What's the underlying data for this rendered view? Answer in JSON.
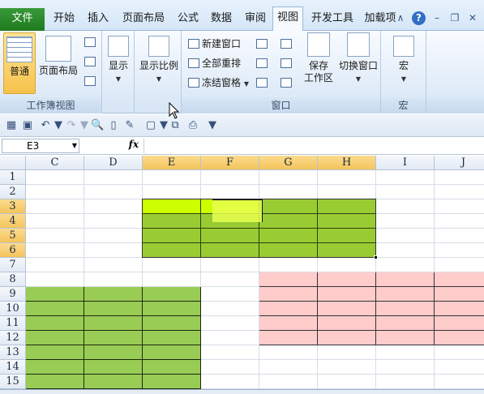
{
  "tabs": {
    "file": "文件",
    "items": [
      "开始",
      "插入",
      "页面布局",
      "公式",
      "数据",
      "审阅",
      "视图",
      "开发工具",
      "加载项"
    ],
    "active": "视图"
  },
  "ribbon": {
    "workbook_views": {
      "normal": "普通",
      "page_layout": "页面布局",
      "group_label": "工作簿视图"
    },
    "show": {
      "label": "显示"
    },
    "zoom": {
      "label": "显示比例"
    },
    "window": {
      "new_window": "新建窗口",
      "arrange_all": "全部重排",
      "freeze_panes": "冻结窗格",
      "save_workspace_line1": "保存",
      "save_workspace_line2": "工作区",
      "switch_windows": "切换窗口",
      "group_label": "窗口"
    },
    "macros": {
      "label": "宏",
      "group_label": "宏"
    }
  },
  "formula_bar": {
    "name_box": "E3",
    "fx": "fx",
    "formula": ""
  },
  "sheet": {
    "columns": [
      "C",
      "D",
      "E",
      "F",
      "G",
      "H",
      "I",
      "J"
    ],
    "rows": [
      "1",
      "2",
      "3",
      "4",
      "5",
      "6",
      "7",
      "8",
      "9",
      "10",
      "11",
      "12",
      "13",
      "14",
      "15"
    ],
    "active_cell": "E3",
    "colors": {
      "green_block": "#99cc33",
      "active_highlight": "#ccff00",
      "lower_green_block": "#99cc55",
      "pink_block": "#ffcccc"
    }
  },
  "colors": {
    "file_tab": "#2a8a2a",
    "header_highlight": "#f5c45b"
  }
}
